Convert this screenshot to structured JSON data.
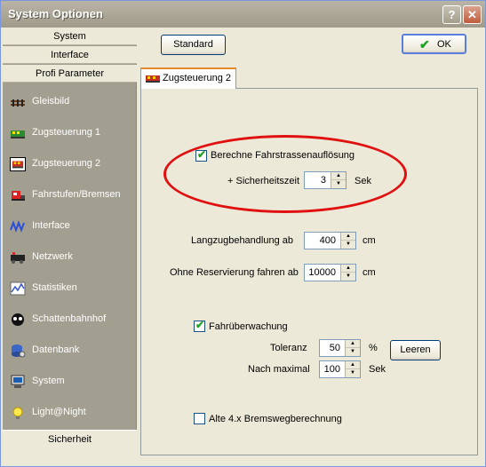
{
  "window": {
    "title": "System Optionen",
    "help_label": "?",
    "close_label": "✕"
  },
  "leftpanel": {
    "headers": [
      "System",
      "Interface",
      "Profi Parameter"
    ],
    "items": [
      {
        "label": "Gleisbild",
        "icon": "track-icon"
      },
      {
        "label": "Zugsteuerung 1",
        "icon": "train-control-icon"
      },
      {
        "label": "Zugsteuerung 2",
        "icon": "train-control-2-icon"
      },
      {
        "label": "Fahrstufen/Bremsen",
        "icon": "speed-steps-icon"
      },
      {
        "label": "Interface",
        "icon": "interface-icon"
      },
      {
        "label": "Netzwerk",
        "icon": "network-icon"
      },
      {
        "label": "Statistiken",
        "icon": "statistics-icon"
      },
      {
        "label": "Schattenbahnhof",
        "icon": "shadow-station-icon"
      },
      {
        "label": "Datenbank",
        "icon": "database-icon"
      },
      {
        "label": "System",
        "icon": "system-icon"
      },
      {
        "label": "Light@Night",
        "icon": "light-icon"
      }
    ],
    "footer": "Sicherheit"
  },
  "toolbar": {
    "standard_label": "Standard",
    "ok_label": "OK"
  },
  "tab": {
    "label": "Zugsteuerung 2"
  },
  "settings": {
    "route_dissolve_label": "Berechne Fahrstrassenauflösung",
    "safety_time_label": "+ Sicherheitszeit",
    "safety_time_value": "3",
    "safety_time_unit": "Sek",
    "long_train_label": "Langzugbehandlung ab",
    "long_train_value": "400",
    "long_train_unit": "cm",
    "no_reservation_label": "Ohne Reservierung fahren ab",
    "no_reservation_value": "10000",
    "no_reservation_unit": "cm",
    "monitoring_label": "Fahrüberwachung",
    "tolerance_label": "Toleranz",
    "tolerance_value": "50",
    "tolerance_unit": "%",
    "clear_label": "Leeren",
    "max_label": "Nach maximal",
    "max_value": "100",
    "max_unit": "Sek",
    "old_brake_label": "Alte 4.x Bremswegberechnung"
  },
  "colors": {
    "annotation": "#e01010",
    "accent": "#21a121"
  }
}
